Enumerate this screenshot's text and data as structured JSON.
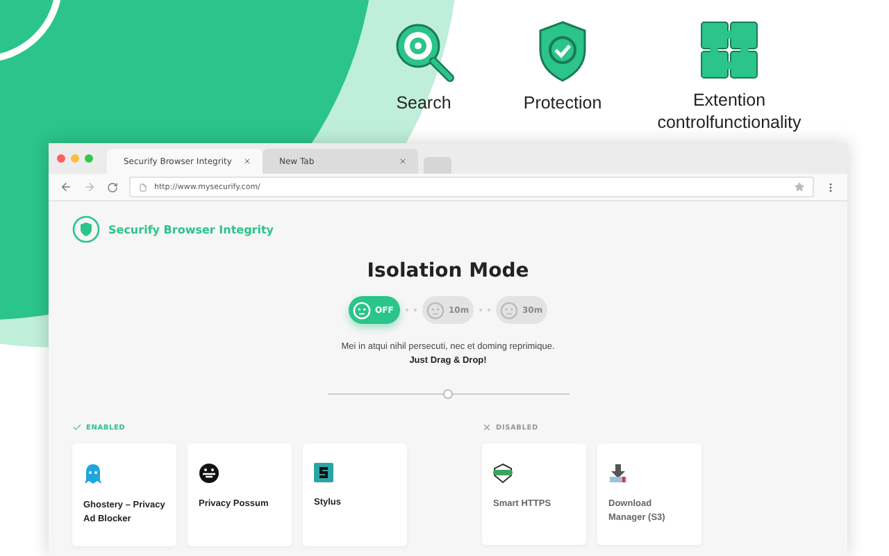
{
  "features": [
    {
      "label": "Search"
    },
    {
      "label": "Protection"
    },
    {
      "label": "Extention controlfunctionality"
    }
  ],
  "browser": {
    "tabs": [
      {
        "label": "Securify Browser Integrity",
        "selected": true
      },
      {
        "label": "New Tab",
        "selected": false
      }
    ],
    "url": "http://www.mysecurify.com/"
  },
  "app": {
    "brand": "Securify Browser Integrity",
    "title": "Isolation Mode",
    "modes": [
      {
        "label": "OFF",
        "selected": true
      },
      {
        "label": "10m",
        "selected": false
      },
      {
        "label": "30m",
        "selected": false
      }
    ],
    "description": "Mei in atqui nihil persecuti, nec et doming reprimique.",
    "hint": "Just Drag & Drop!",
    "slider": {
      "level": 0.5
    },
    "sections": [
      {
        "kind": "enabled",
        "label": "ENABLED",
        "items": [
          {
            "name": "Ghostery – Privacy Ad Blocker"
          },
          {
            "name": "Privacy Possum"
          },
          {
            "name": "Stylus"
          }
        ]
      },
      {
        "kind": "disabled",
        "label": "DISABLED",
        "items": [
          {
            "name": "Smart HTTPS"
          },
          {
            "name": "Download Manager (S3)"
          }
        ]
      }
    ]
  }
}
